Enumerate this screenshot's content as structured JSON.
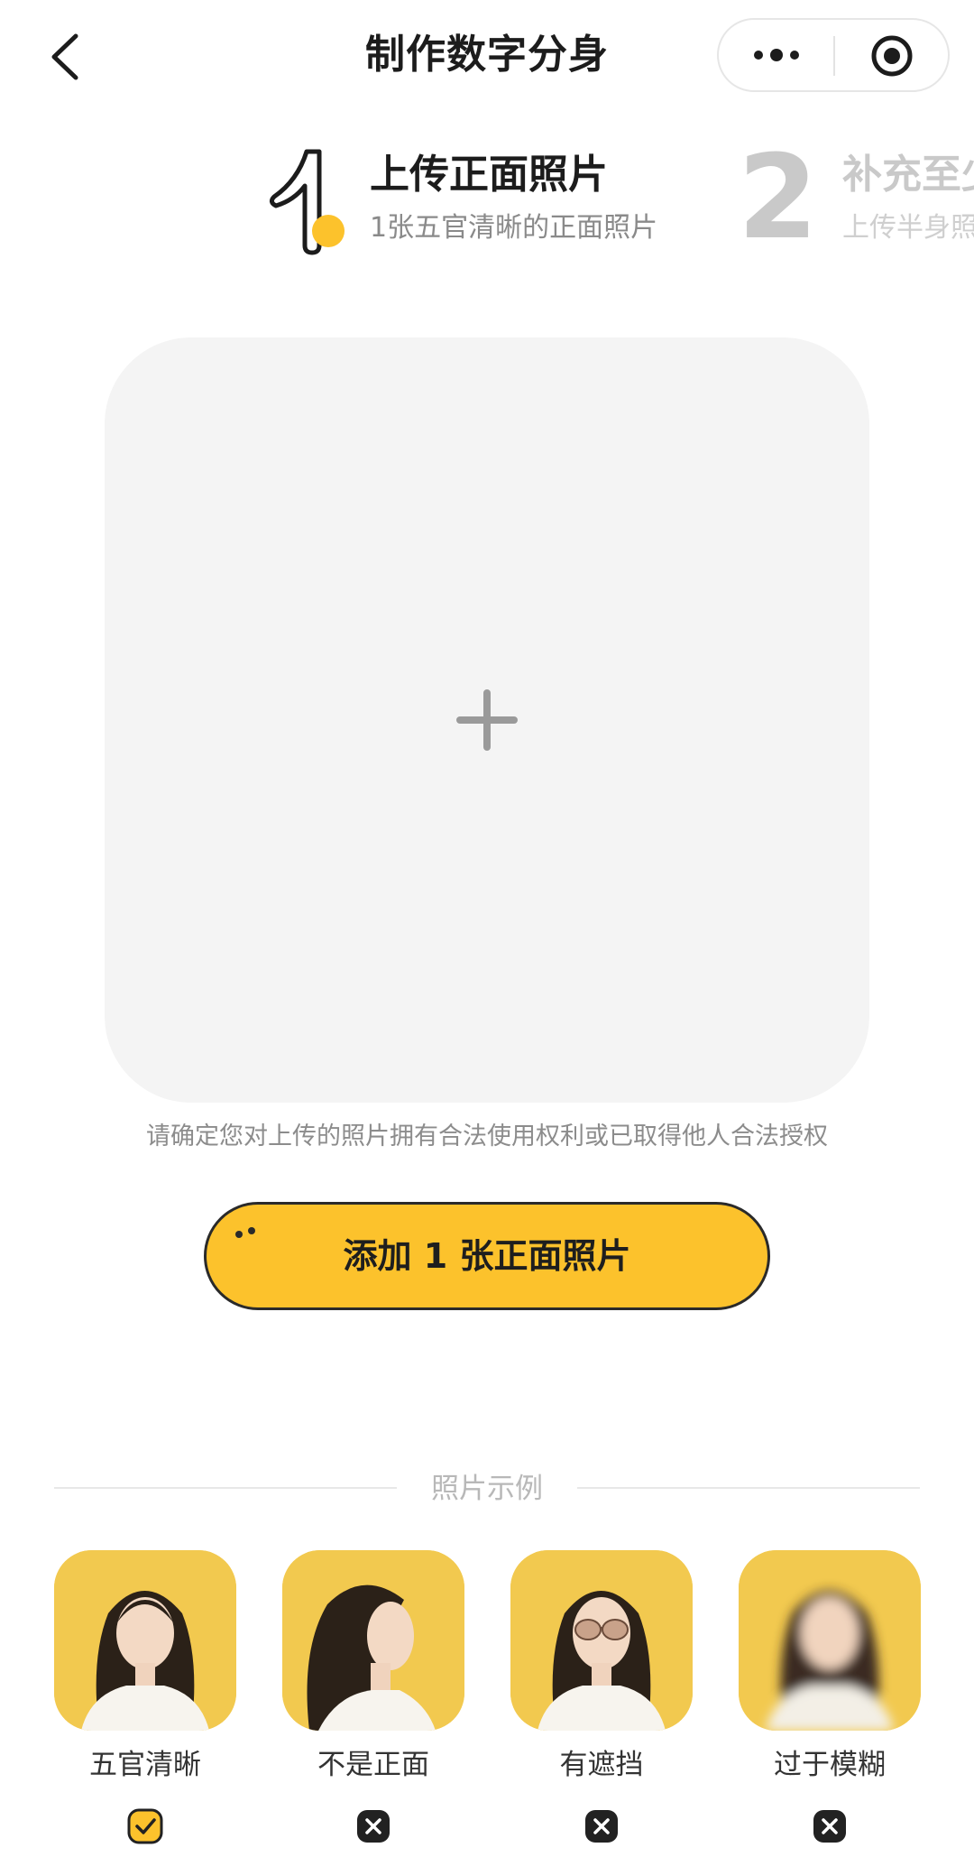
{
  "header": {
    "title": "制作数字分身",
    "back_icon": "chevron-left-icon",
    "more_icon": "more-dots-icon",
    "target_icon": "target-icon"
  },
  "steps": [
    {
      "number": "1",
      "title": "上传正面照片",
      "subtitle": "1张五官清晰的正面照片",
      "active": true
    },
    {
      "number": "2",
      "title": "补充至少",
      "subtitle": "上传半身照",
      "active": false
    }
  ],
  "upload": {
    "icon": "plus-icon",
    "disclaimer": "请确定您对上传的照片拥有合法使用权利或已取得他人合法授权"
  },
  "add_button": {
    "label": "添加 1 张正面照片"
  },
  "examples": {
    "title": "照片示例",
    "items": [
      {
        "label": "五官清晰",
        "status": "ok",
        "icon": "check-icon"
      },
      {
        "label": "不是正面",
        "status": "bad",
        "icon": "cross-icon"
      },
      {
        "label": "有遮挡",
        "status": "bad",
        "icon": "cross-icon"
      },
      {
        "label": "过于模糊",
        "status": "bad",
        "icon": "cross-icon"
      }
    ]
  },
  "colors": {
    "accent": "#fcc22c",
    "upload_bg": "#f4f4f4",
    "thumb_bg": "#f2c94f"
  }
}
